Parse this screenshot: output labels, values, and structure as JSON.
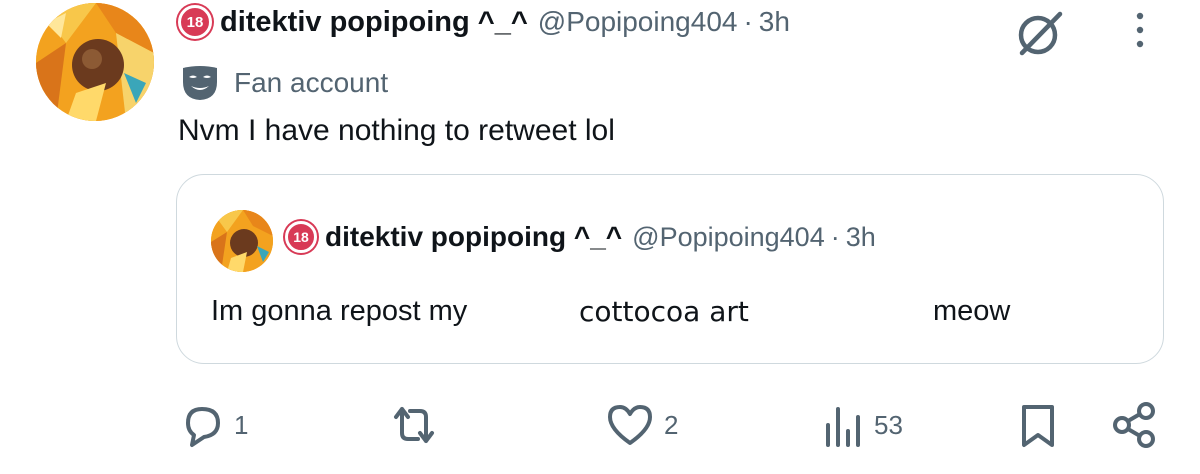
{
  "tweet": {
    "display_name": "ditektiv popipoing ^_^",
    "handle": "@Popipoing404",
    "time": "3h",
    "badge_text": "18",
    "label": "Fan account",
    "text": "Nvm I have nothing to retweet lol"
  },
  "quote": {
    "display_name": "ditektiv popipoing ^_^",
    "handle": "@Popipoing404",
    "time": "3h",
    "badge_text": "18",
    "text_part1": "Im gonna repost my",
    "text_part2": "cottocoa art",
    "text_part3": "meow"
  },
  "actions": {
    "replies": "1",
    "reposts": "",
    "likes": "2",
    "views": "53"
  },
  "icons": {
    "reply": "reply-icon",
    "repost": "repost-icon",
    "like": "heart-icon",
    "views": "views-icon",
    "bookmark": "bookmark-icon",
    "share": "share-icon",
    "grok": "grok-icon",
    "more": "more-icon",
    "label": "mask-icon"
  },
  "colors": {
    "text": "#0f1419",
    "secondary": "#536471",
    "badge": "#d83a56",
    "border": "#cfd9de"
  }
}
